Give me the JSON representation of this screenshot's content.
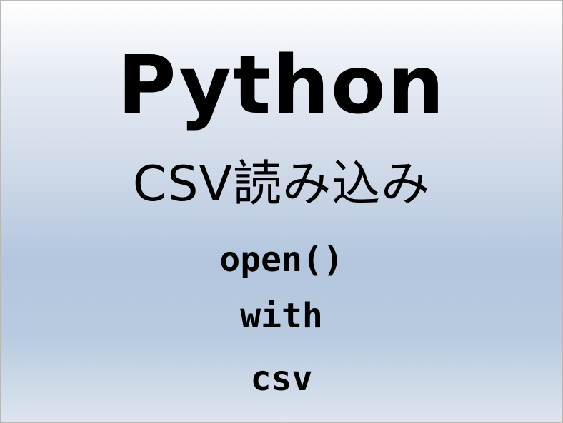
{
  "slide": {
    "title": "Python",
    "subtitle": "CSV読み込み",
    "lines": [
      "open()",
      "with",
      "csv"
    ]
  }
}
